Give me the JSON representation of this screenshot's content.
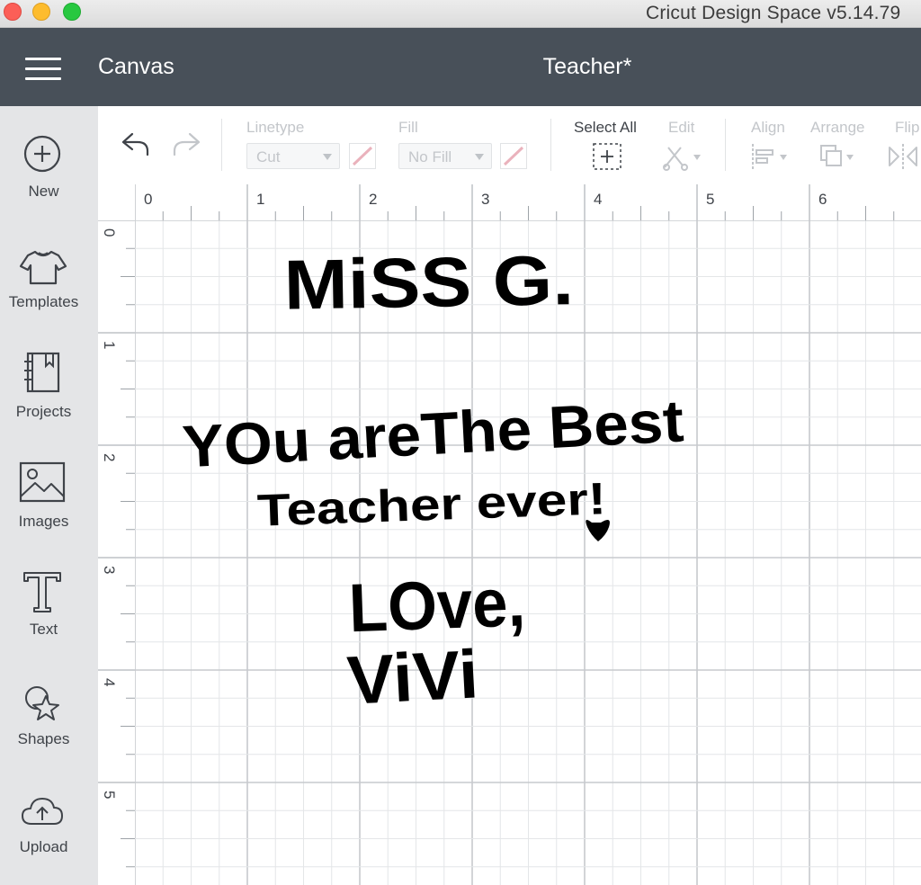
{
  "window": {
    "app_title": "Cricut Design Space  v5.14.79"
  },
  "header": {
    "section": "Canvas",
    "project_name": "Teacher*"
  },
  "sidebar": {
    "items": [
      {
        "label": "New",
        "icon": "plus-circle-icon"
      },
      {
        "label": "Templates",
        "icon": "tshirt-icon"
      },
      {
        "label": "Projects",
        "icon": "notebook-icon"
      },
      {
        "label": "Images",
        "icon": "image-icon"
      },
      {
        "label": "Text",
        "icon": "text-t-icon"
      },
      {
        "label": "Shapes",
        "icon": "shapes-icon"
      },
      {
        "label": "Upload",
        "icon": "cloud-upload-icon"
      }
    ]
  },
  "toolbar": {
    "linetype_label": "Linetype",
    "linetype_value": "Cut",
    "fill_label": "Fill",
    "fill_value": "No Fill",
    "select_all_label": "Select All",
    "edit_label": "Edit",
    "align_label": "Align",
    "arrange_label": "Arrange",
    "flip_label": "Flip"
  },
  "rulers": {
    "horizontal": [
      "0",
      "1",
      "2",
      "3",
      "4",
      "5",
      "6"
    ],
    "vertical": [
      "0",
      "1",
      "2",
      "3",
      "4",
      "5"
    ]
  },
  "canvas_text": {
    "line1": "MiSS G.",
    "line2": "YOu areThe Best",
    "line3": "Teacher  ever!",
    "line4": "LOve,",
    "line5": "ViVi"
  },
  "colors": {
    "header_bg": "#485059",
    "sidebar_bg": "#e4e5e7",
    "grid_minor": "#e4e6e8",
    "grid_major": "#c7cacd",
    "ink": "#000000"
  }
}
